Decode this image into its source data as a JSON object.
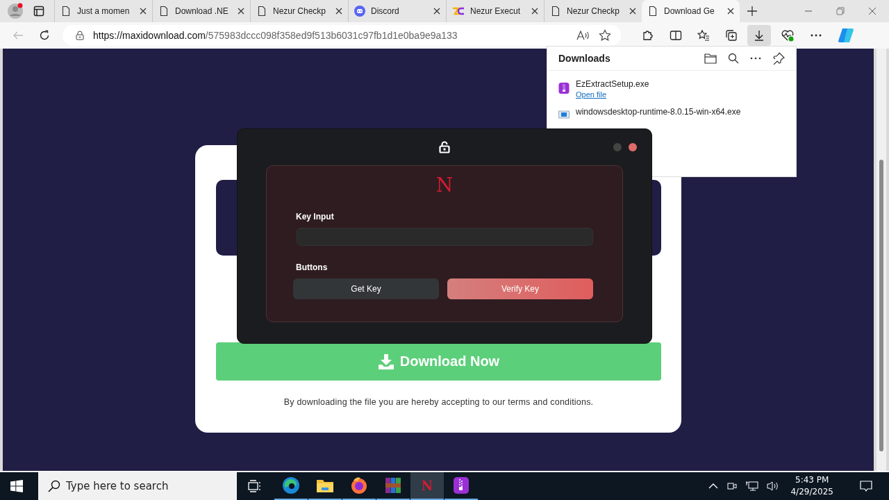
{
  "browser": {
    "tabs": [
      {
        "title": "Just a momen",
        "kind": "page",
        "selected": false
      },
      {
        "title": "Download .NE",
        "kind": "page",
        "selected": false
      },
      {
        "title": "Nezur Checkp",
        "kind": "page",
        "selected": false
      },
      {
        "title": "Discord",
        "kind": "discord",
        "selected": false
      },
      {
        "title": "Nezur Execut",
        "kind": "nezur",
        "selected": false
      },
      {
        "title": "Nezur Checkp",
        "kind": "page",
        "selected": false
      },
      {
        "title": "Download Ge",
        "kind": "page",
        "selected": true
      }
    ],
    "url_host": "https://maxidownload.com",
    "url_path": "/575983dccc098f358ed9f513b6031c97fb1d1e0ba9e9a133",
    "downloads_open": true
  },
  "downloads_panel": {
    "title": "Downloads",
    "items": [
      {
        "name": "EzExtractSetup.exe",
        "kind": "ezextract",
        "action": "Open file"
      },
      {
        "name": "windowsdesktop-runtime-8.0.15-win-x64.exe",
        "kind": "installer"
      }
    ]
  },
  "page": {
    "download_button": "Download Now",
    "terms": "By downloading the file you are hereby accepting to our terms and conditions."
  },
  "key_window": {
    "logo": "N",
    "key_label": "Key Input",
    "buttons_label": "Buttons",
    "buttons": [
      {
        "label": "Get Key",
        "kind": "secondary"
      },
      {
        "label": "Verify Key",
        "kind": "primary"
      }
    ]
  },
  "taskbar": {
    "search_placeholder": "Type here to search",
    "apps": [
      {
        "kind": "edge",
        "selected": false
      },
      {
        "kind": "folder",
        "selected": false
      },
      {
        "kind": "firefox",
        "selected": false
      },
      {
        "kind": "winrar",
        "selected": false
      },
      {
        "kind": "nezur",
        "label": "N",
        "selected": true
      },
      {
        "kind": "ezextract",
        "selected": false
      }
    ],
    "time": "5:43 PM",
    "date": "4/29/2025"
  }
}
